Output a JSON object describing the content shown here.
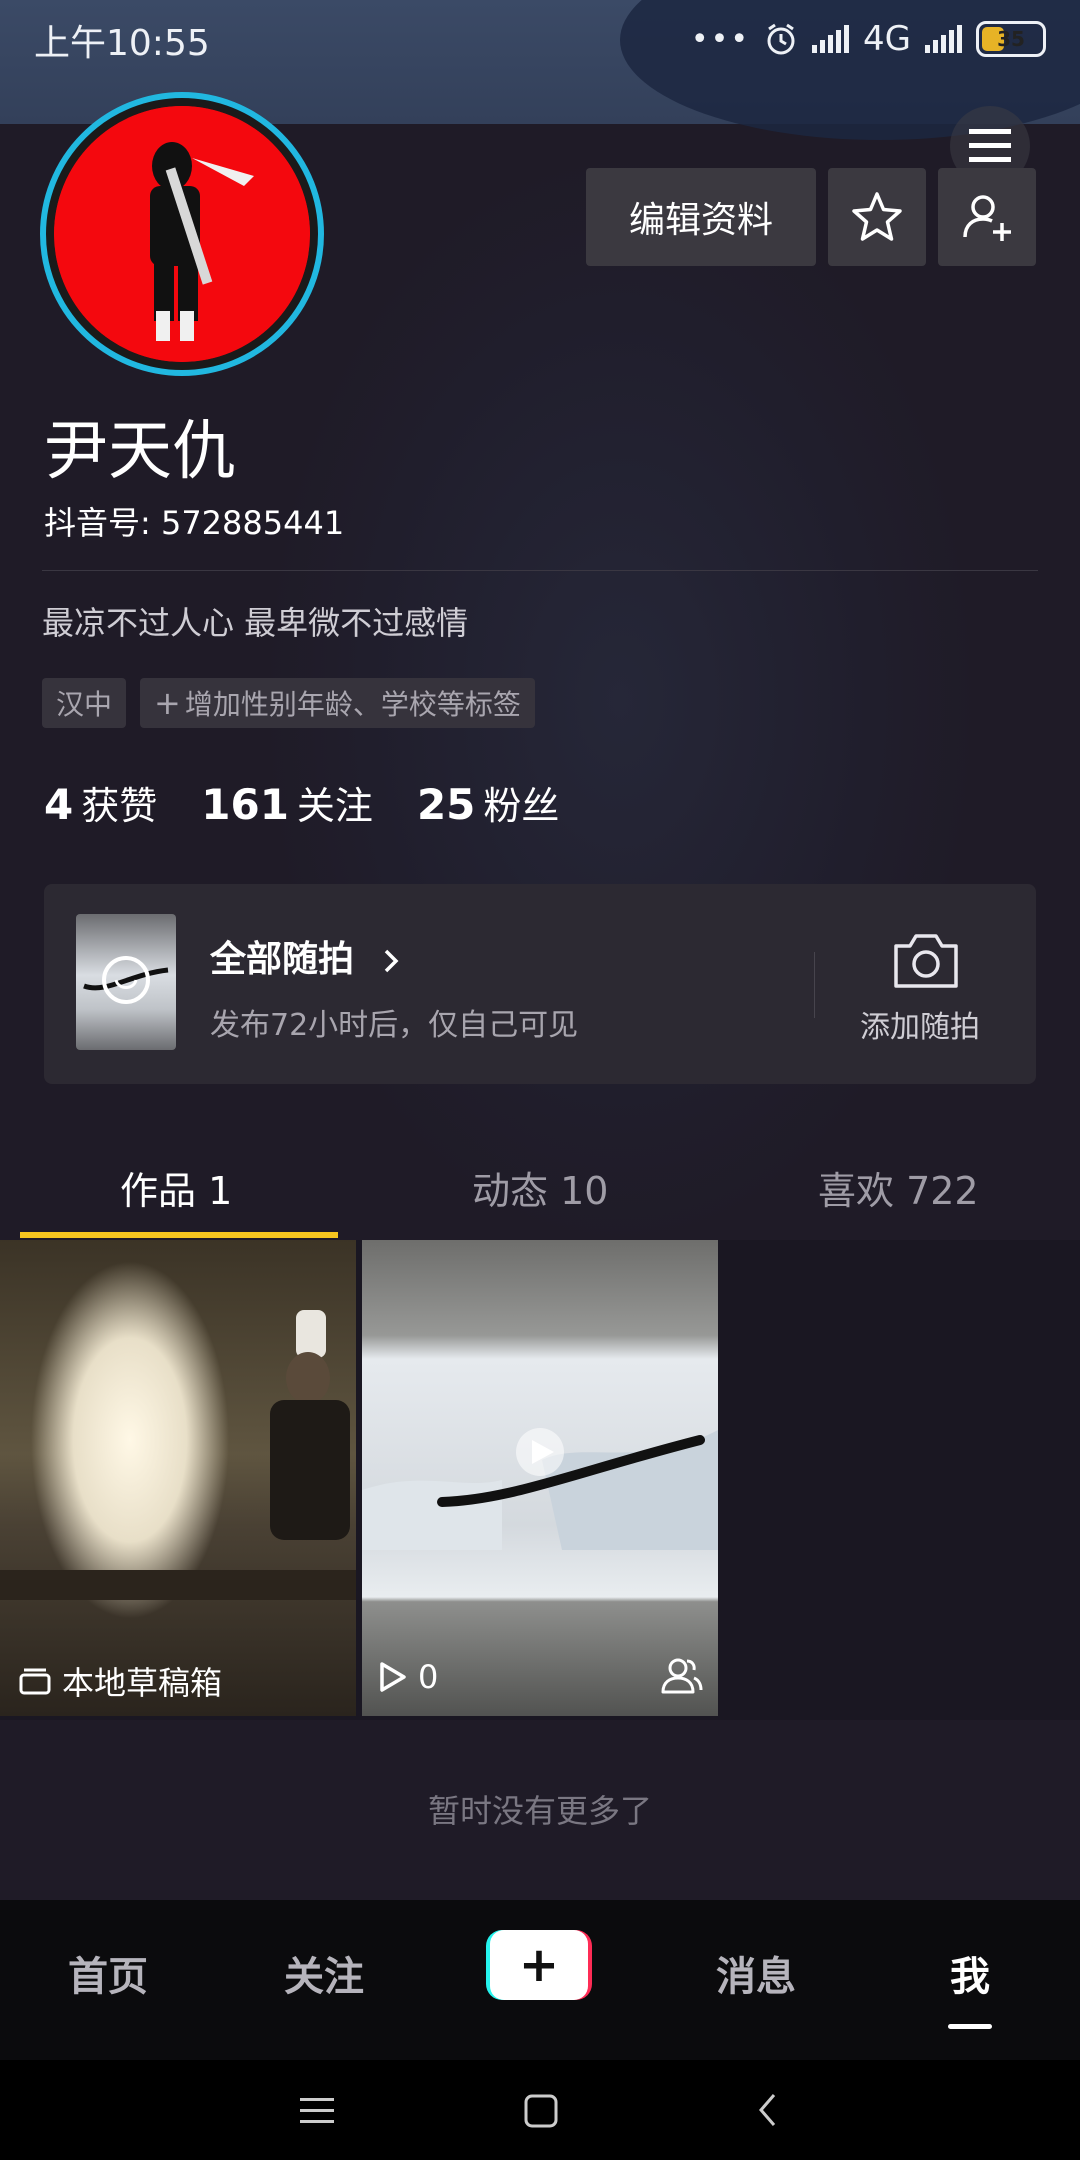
{
  "status_bar": {
    "time": "上午10:55",
    "network": "4G",
    "battery": "35"
  },
  "profile": {
    "name": "尹天仇",
    "douyin_id": "抖音号: 572885441",
    "bio": "最凉不过人心 最卑微不过感情",
    "tags": {
      "location": "汉中",
      "add": "增加性别年龄、学校等标签"
    },
    "edit_label": "编辑资料"
  },
  "stats": [
    {
      "value": "4",
      "label": "获赞"
    },
    {
      "value": "161",
      "label": "关注"
    },
    {
      "value": "25",
      "label": "粉丝"
    }
  ],
  "random_shot": {
    "title": "全部随拍",
    "subtitle": "发布72小时后，仅自己可见",
    "add_label": "添加随拍"
  },
  "tabs": [
    {
      "label": "作品 1"
    },
    {
      "label": "动态 10"
    },
    {
      "label": "喜欢 722"
    }
  ],
  "grid": {
    "draft_label": "本地草稿箱",
    "play_count": "0"
  },
  "no_more": "暂时没有更多了",
  "bottom_nav": {
    "home": "首页",
    "follow": "关注",
    "messages": "消息",
    "me": "我"
  },
  "colors": {
    "accent": "#f6c51f",
    "avatar_ring": "#21b8e0",
    "tiktok_cyan": "#25f4ee",
    "tiktok_red": "#fe2c55"
  },
  "icons": [
    "menu-icon",
    "star-icon",
    "add-user-icon",
    "camera-icon",
    "chevron-right-icon",
    "draft-box-icon",
    "play-icon",
    "friends-icon",
    "plus-icon",
    "recents-icon",
    "home-icon",
    "back-icon"
  ]
}
